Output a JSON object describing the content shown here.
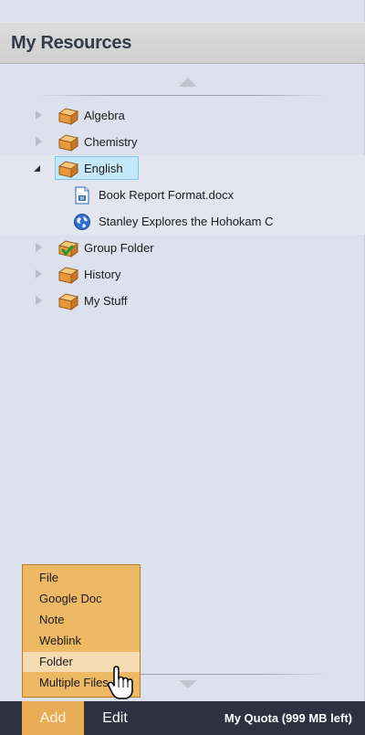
{
  "header": {
    "title": "My Resources"
  },
  "tree": {
    "items": [
      {
        "label": "Algebra",
        "icon": "folder-icon",
        "expanded": false
      },
      {
        "label": "Chemistry",
        "icon": "folder-icon",
        "expanded": false
      },
      {
        "label": "English",
        "icon": "folder-icon",
        "expanded": true,
        "selected": true,
        "children": [
          {
            "label": "Book Report Format.docx",
            "icon": "document-icon"
          },
          {
            "label": "Stanley Explores the Hohokam C",
            "icon": "globe-icon"
          }
        ]
      },
      {
        "label": "Group Folder",
        "icon": "shared-folder-icon",
        "expanded": false
      },
      {
        "label": "History",
        "icon": "folder-icon",
        "expanded": false
      },
      {
        "label": "My Stuff",
        "icon": "folder-icon",
        "expanded": false
      }
    ]
  },
  "add_menu": {
    "items": [
      "File",
      "Google Doc",
      "Note",
      "Weblink",
      "Folder",
      "Multiple Files"
    ],
    "hovered": "Folder"
  },
  "footer": {
    "add_label": "Add",
    "edit_label": "Edit",
    "quota_label": "My Quota (999 MB left)"
  },
  "colors": {
    "panel_bg": "#dde1ee",
    "footer_bg": "#2e3240",
    "accent": "#e8ac56",
    "selection": "#c6e8fb"
  }
}
